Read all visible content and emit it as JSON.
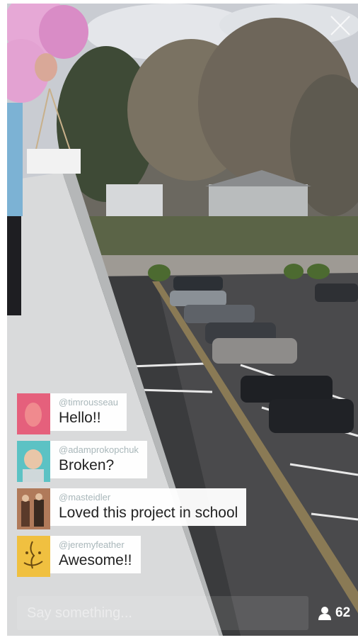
{
  "comments": [
    {
      "handle": "@timrousseau",
      "message": "Hello!!",
      "avatar": "pink-egg-avatar"
    },
    {
      "handle": "@adamprokopchuk",
      "message": "Broken?",
      "avatar": "baby-photo-avatar"
    },
    {
      "handle": "@masteidler",
      "message": "Loved this project in school",
      "avatar": "vintage-photo-avatar"
    },
    {
      "handle": "@jeremyfeather",
      "message": "Awesome!!",
      "avatar": "finder-face-avatar"
    }
  ],
  "composer": {
    "placeholder": "Say something..."
  },
  "viewers": {
    "count": "62",
    "icon": "person-icon"
  },
  "colors": {
    "bubble": "#ffffff",
    "handle": "#a9b7ba",
    "message": "#222222"
  }
}
